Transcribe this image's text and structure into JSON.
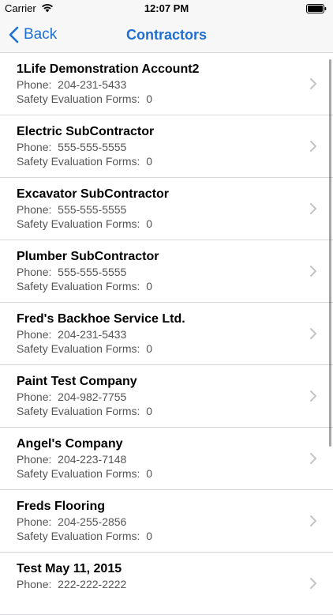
{
  "status_bar": {
    "carrier": "Carrier",
    "time": "12:07 PM"
  },
  "nav": {
    "back_label": "Back",
    "title": "Contractors"
  },
  "labels": {
    "phone": "Phone:",
    "forms": "Safety Evaluation Forms:"
  },
  "contractors": [
    {
      "name": "1Life Demonstration Account2",
      "phone": "204-231-5433",
      "forms": "0"
    },
    {
      "name": "Electric SubContractor",
      "phone": "555-555-5555",
      "forms": "0"
    },
    {
      "name": "Excavator SubContractor",
      "phone": "555-555-5555",
      "forms": "0"
    },
    {
      "name": "Plumber SubContractor",
      "phone": "555-555-5555",
      "forms": "0"
    },
    {
      "name": "Fred's Backhoe Service Ltd.",
      "phone": "204-231-5433",
      "forms": "0"
    },
    {
      "name": "Paint Test Company",
      "phone": "204-982-7755",
      "forms": "0"
    },
    {
      "name": "Angel's Company",
      "phone": "204-223-7148",
      "forms": "0"
    },
    {
      "name": "Freds Flooring",
      "phone": "204-255-2856",
      "forms": "0"
    },
    {
      "name": "Test May 11, 2015",
      "phone": "222-222-2222",
      "forms": ""
    }
  ],
  "colors": {
    "accent": "#1f6fd1",
    "separator": "#d8d8dc",
    "secondary_text": "#555555"
  }
}
